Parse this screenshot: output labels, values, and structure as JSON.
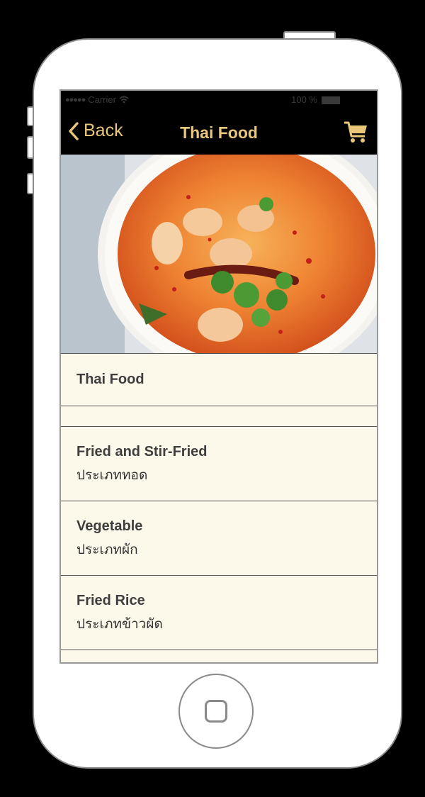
{
  "status_bar": {
    "carrier": "Carrier",
    "battery": "100 %"
  },
  "nav": {
    "back_label": "Back",
    "title": "Thai Food",
    "cart_icon": "cart-icon",
    "accent_color": "#e9c77a"
  },
  "hero": {
    "description_icon": "tom-yum-soup-photo"
  },
  "list": {
    "header": "Thai Food",
    "items": [
      {
        "title": "Fried and Stir-Fried",
        "subtitle": "ประเภททอด"
      },
      {
        "title": "Vegetable",
        "subtitle": "ประเภทผัก"
      },
      {
        "title": "Fried Rice",
        "subtitle": "ประเภทข้าวผัด"
      }
    ],
    "row_background": "#fdf9ea"
  }
}
